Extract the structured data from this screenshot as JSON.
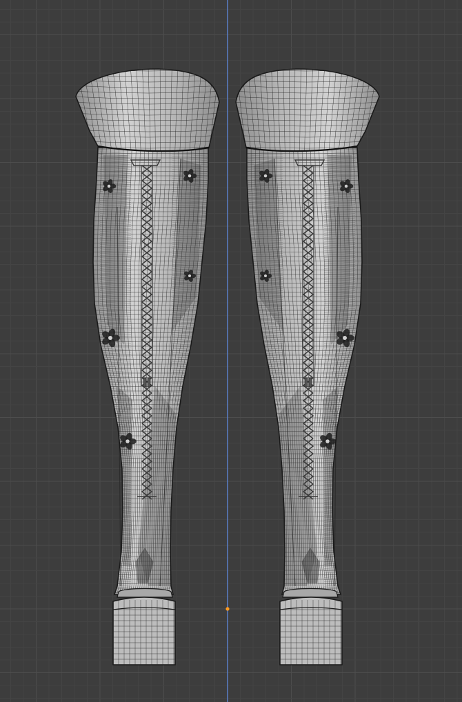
{
  "viewport": {
    "background": "#3d3d3d",
    "grid_minor_color": "#444444",
    "grid_major_color": "#4d4d4d",
    "axis_color": "#5a7fc6",
    "origin_color": "#ff9a1f"
  },
  "mesh": {
    "surface_color": "#b5b5b5",
    "surface_shadow_color": "#8e8e8e",
    "surface_highlight_color": "#d2d2d2",
    "wire_color": "#262626",
    "lace_color": "#3a3a3a",
    "objects": [
      "left-boot",
      "right-boot"
    ]
  }
}
